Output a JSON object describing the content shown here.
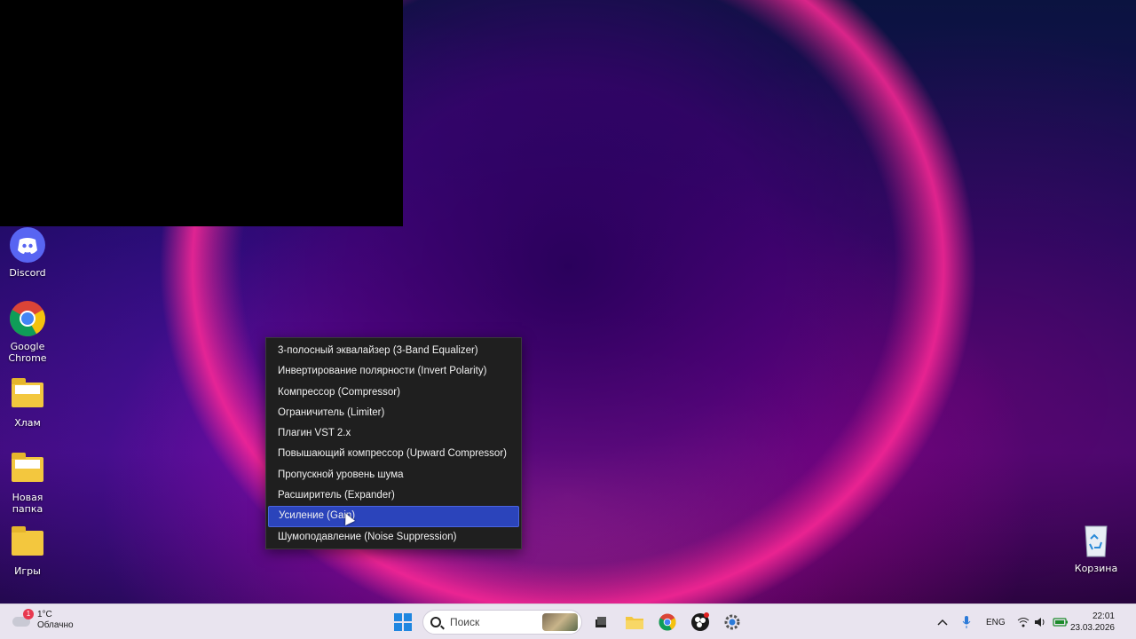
{
  "desktop": {
    "icons": [
      {
        "label": "Discord",
        "icon": "discord-icon"
      },
      {
        "label": "Google Chrome",
        "icon": "chrome-icon"
      },
      {
        "label": "Хлам",
        "icon": "folder-icon"
      },
      {
        "label": "Новая папка",
        "icon": "folder-icon"
      },
      {
        "label": "Игры",
        "icon": "folder-icon"
      },
      {
        "label": "Корзина",
        "icon": "recycle-bin-icon"
      }
    ]
  },
  "context_menu": {
    "items": [
      {
        "label": "3-полосный эквалайзер (3-Band Equalizer)",
        "selected": false
      },
      {
        "label": "Инвертирование полярности (Invert Polarity)",
        "selected": false
      },
      {
        "label": "Компрессор (Compressor)",
        "selected": false
      },
      {
        "label": "Ограничитель (Limiter)",
        "selected": false
      },
      {
        "label": "Плагин VST 2.x",
        "selected": false
      },
      {
        "label": "Повышающий компрессор (Upward Compressor)",
        "selected": false
      },
      {
        "label": "Пропускной уровень шума",
        "selected": false
      },
      {
        "label": "Расширитель (Expander)",
        "selected": false
      },
      {
        "label": "Усиление (Gain)",
        "selected": true
      },
      {
        "label": "Шумоподавление (Noise Suppression)",
        "selected": false
      }
    ]
  },
  "taskbar": {
    "weather": {
      "temp": "1°C",
      "condition": "Облачно",
      "badge": "1"
    },
    "search_placeholder": "Поиск",
    "tray": {
      "language": "ENG"
    },
    "clock": {
      "time": "22:01",
      "date": "23.03.2026"
    }
  },
  "colors": {
    "menu_bg": "#1f1f1f",
    "menu_selected": "#2b44bb",
    "taskbar_bg": "#e9e4ef"
  }
}
